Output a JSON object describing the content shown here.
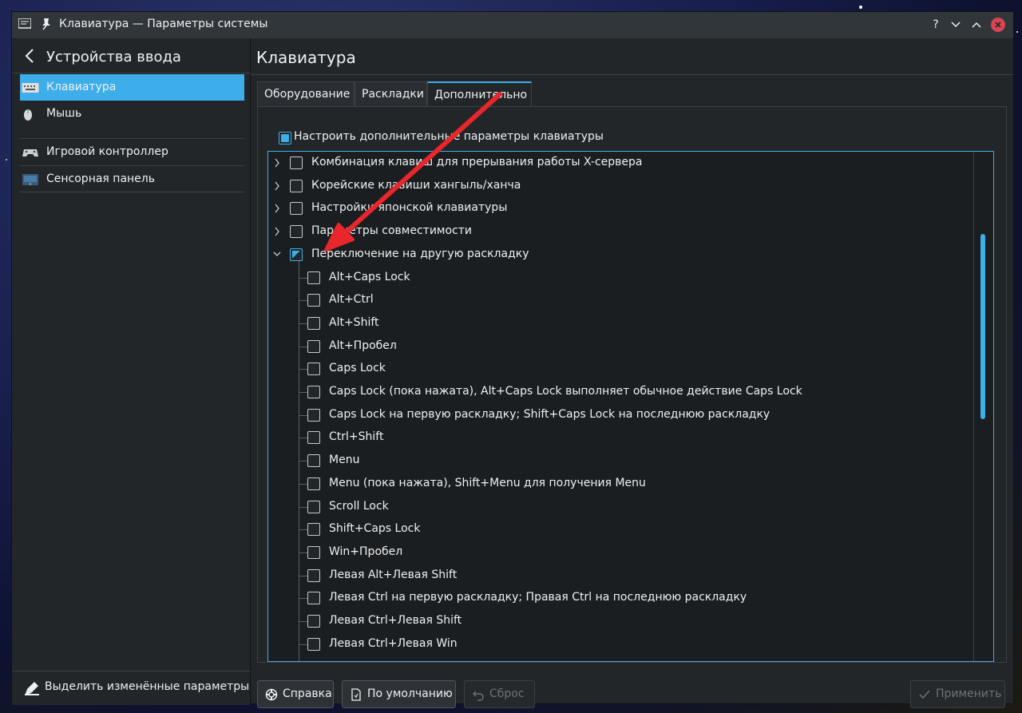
{
  "titlebar": {
    "title": "Клавиатура — Параметры системы",
    "help_symbol": "?",
    "min_symbol": "⌄",
    "max_symbol": "⌃",
    "close_symbol": "×"
  },
  "sidebar": {
    "header": "Устройства ввода",
    "items": [
      {
        "label": "Клавиатура",
        "icon": "keyboard-icon",
        "active": true
      },
      {
        "label": "Мышь",
        "icon": "mouse-icon",
        "active": false
      },
      {
        "label": "Игровой контроллер",
        "icon": "gamepad-icon",
        "active": false
      },
      {
        "label": "Сенсорная панель",
        "icon": "touchpad-icon",
        "active": false
      }
    ],
    "bottom_label": "Выделить изменённые параметры"
  },
  "main": {
    "title": "Клавиатура",
    "tabs": [
      "Оборудование",
      "Раскладки",
      "Дополнительно"
    ],
    "active_tab": "Дополнительно",
    "configure_label": "Настроить дополнительные параметры клавиатуры",
    "tree_groups": [
      {
        "label": "Комбинация клавиш для прерывания работы X-сервера",
        "expanded": false
      },
      {
        "label": "Корейские клавиши хангыль/ханча",
        "expanded": false
      },
      {
        "label": "Настройки японской клавиатуры",
        "expanded": false
      },
      {
        "label": "Параметры совместимости",
        "expanded": false
      },
      {
        "label": "Переключение на другую раскладку",
        "expanded": true
      }
    ],
    "switch_options": [
      "Alt+Caps Lock",
      "Alt+Ctrl",
      "Alt+Shift",
      "Alt+Пробел",
      "Caps Lock",
      "Caps Lock (пока нажата), Alt+Caps Lock выполняет обычное действие Caps Lock",
      "Caps Lock на первую раскладку; Shift+Caps Lock на последнюю раскладку",
      "Ctrl+Shift",
      "Menu",
      "Menu (пока нажата), Shift+Menu для получения Menu",
      "Scroll Lock",
      "Shift+Caps Lock",
      "Win+Пробел",
      "Левая Alt+Левая Shift",
      "Левая Ctrl на первую раскладку; Правая Ctrl на последнюю раскладку",
      "Левая Ctrl+Левая Shift",
      "Левая Ctrl+Левая Win"
    ]
  },
  "footer": {
    "help": "Справка",
    "defaults": "По умолчанию",
    "reset": "Сброс",
    "apply": "Применить"
  },
  "colors": {
    "accent": "#3daee9",
    "annotation_arrow": "#e8262b"
  }
}
